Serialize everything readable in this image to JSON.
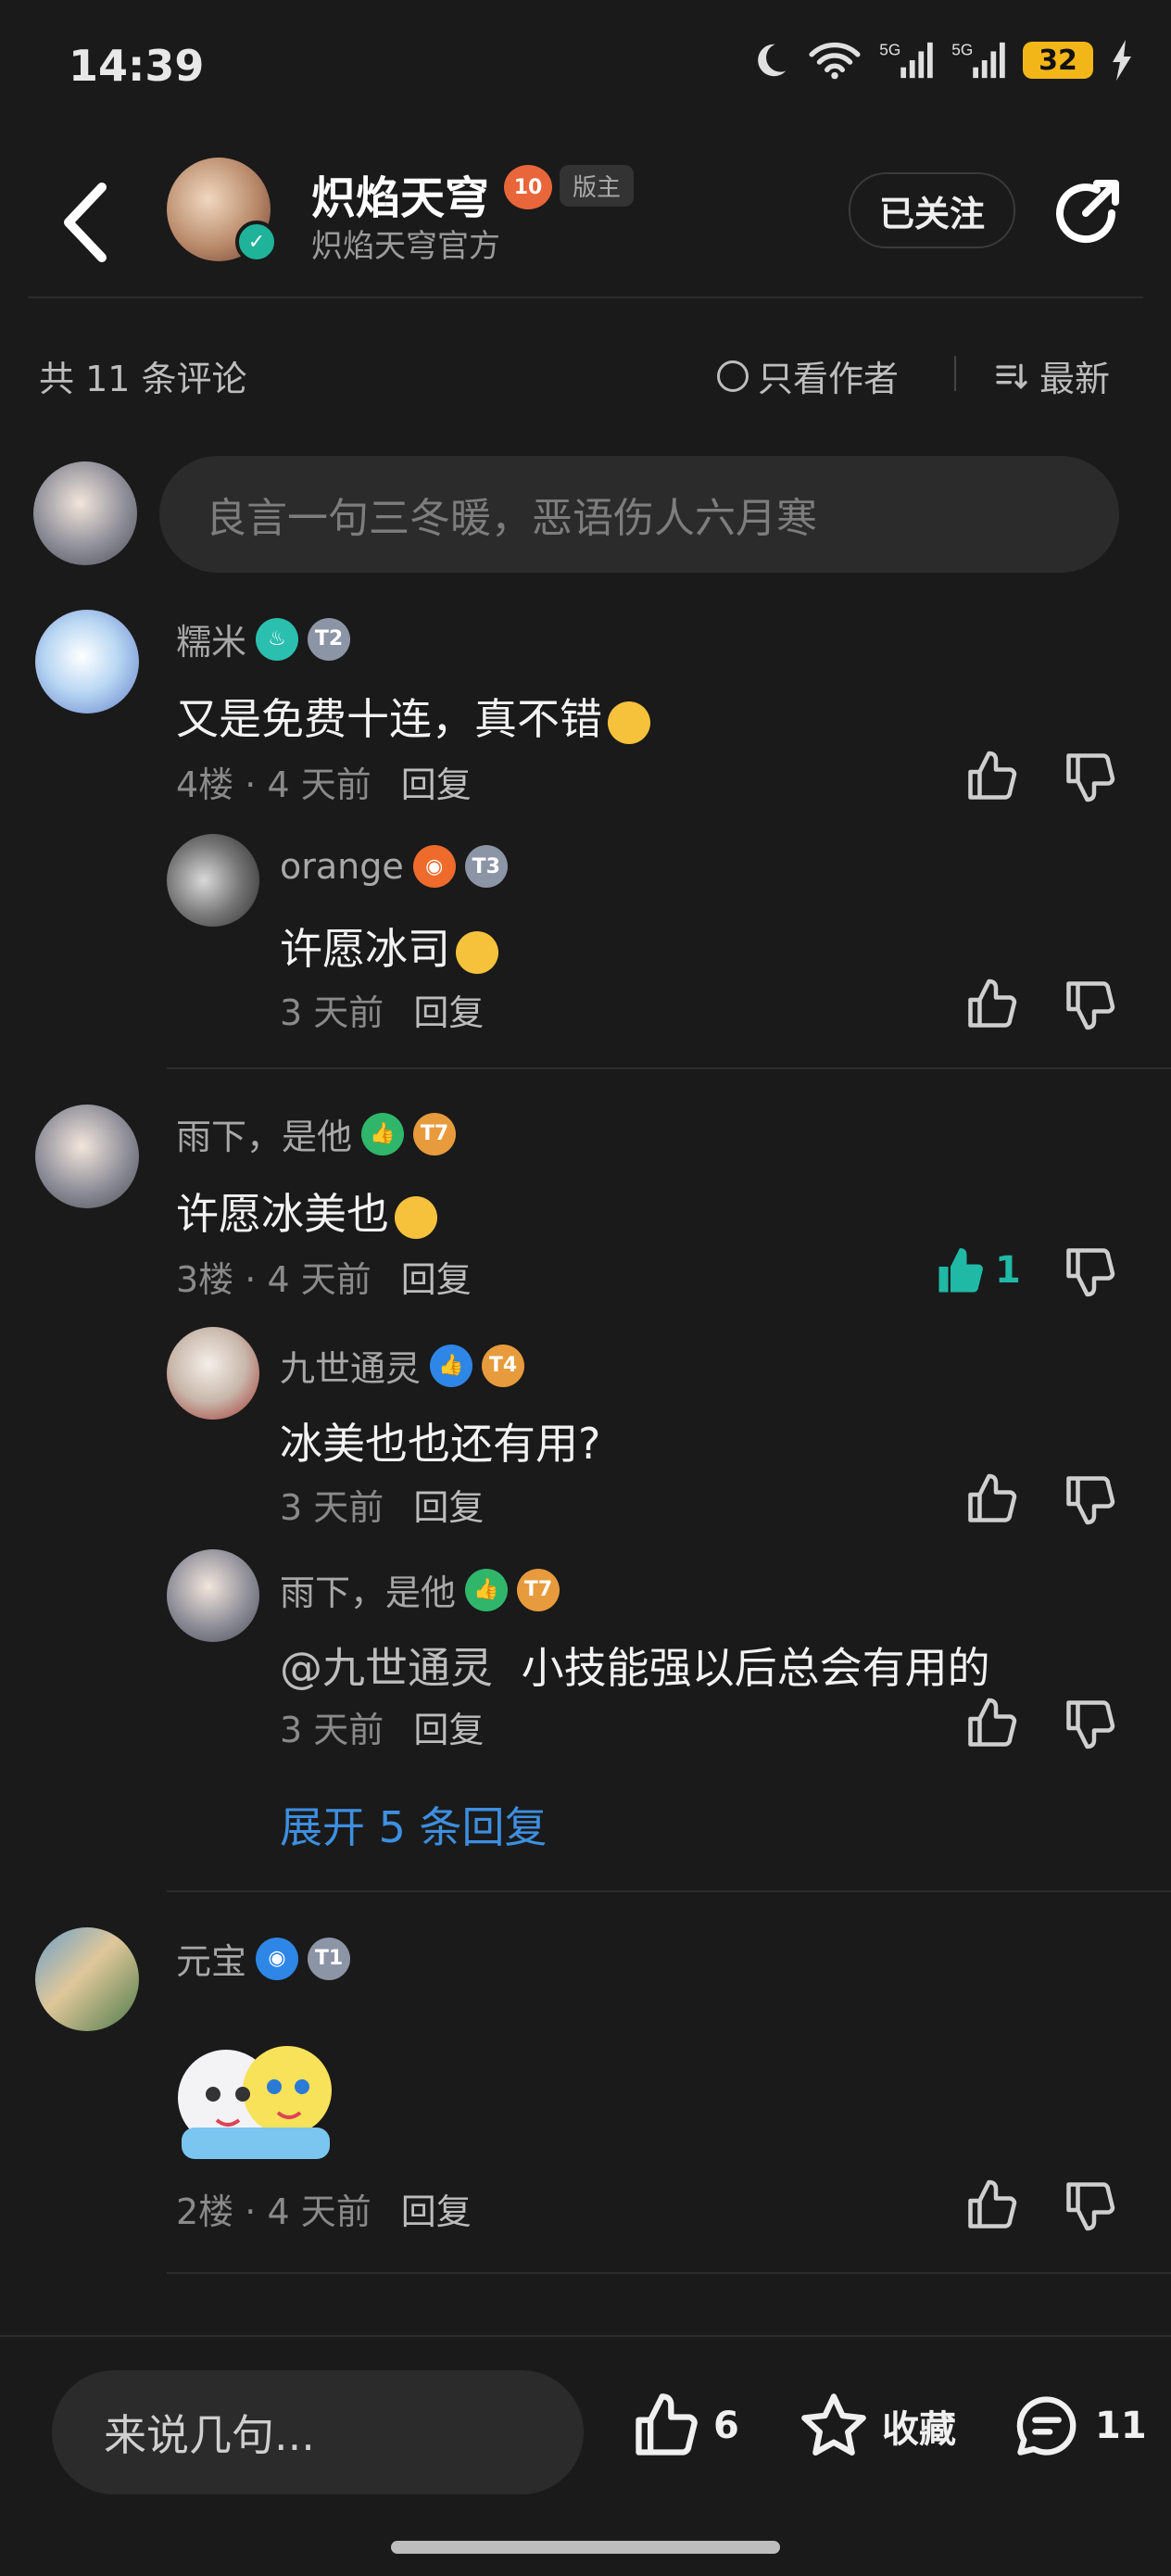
{
  "status_bar": {
    "time": "14:39",
    "battery": "32",
    "network": "5G"
  },
  "header": {
    "title": "炽焰天穹",
    "subtitle": "炽焰天穹官方",
    "level": "10",
    "role_tag": "版主",
    "follow_label": "已关注"
  },
  "filter": {
    "comment_count": "共 11 条评论",
    "only_author": "只看作者",
    "sort": "最新"
  },
  "comment_input": {
    "placeholder": "良言一句三冬暖，恶语伤人六月寒"
  },
  "comments": [
    {
      "user": "糯米",
      "text": "又是免费十连，真不错",
      "floor": "4楼",
      "time": "4 天前",
      "reply_label": "回复",
      "replies": [
        {
          "user": "orange",
          "text": "许愿冰司",
          "time": "3 天前",
          "reply_label": "回复"
        }
      ]
    },
    {
      "user": "雨下，是他",
      "text": "许愿冰美也",
      "floor": "3楼",
      "time": "4 天前",
      "reply_label": "回复",
      "likes": "1",
      "replies": [
        {
          "user": "九世通灵",
          "text": "冰美也也还有用?",
          "time": "3 天前",
          "reply_label": "回复"
        },
        {
          "user": "雨下，是他",
          "mention": "@九世通灵",
          "text": "小技能强以后总会有用的",
          "time": "3 天前",
          "reply_label": "回复"
        }
      ],
      "expand_label": "展开 5 条回复"
    },
    {
      "user": "元宝",
      "floor": "2楼",
      "time": "4 天前",
      "reply_label": "回复"
    }
  ],
  "bottom_bar": {
    "input_placeholder": "来说几句...",
    "like_count": "6",
    "favorite_label": "收藏",
    "comment_count": "11"
  },
  "colors": {
    "accent_teal": "#20b9a5",
    "link_blue": "#3d8fe0",
    "background": "#1a1a1a"
  }
}
